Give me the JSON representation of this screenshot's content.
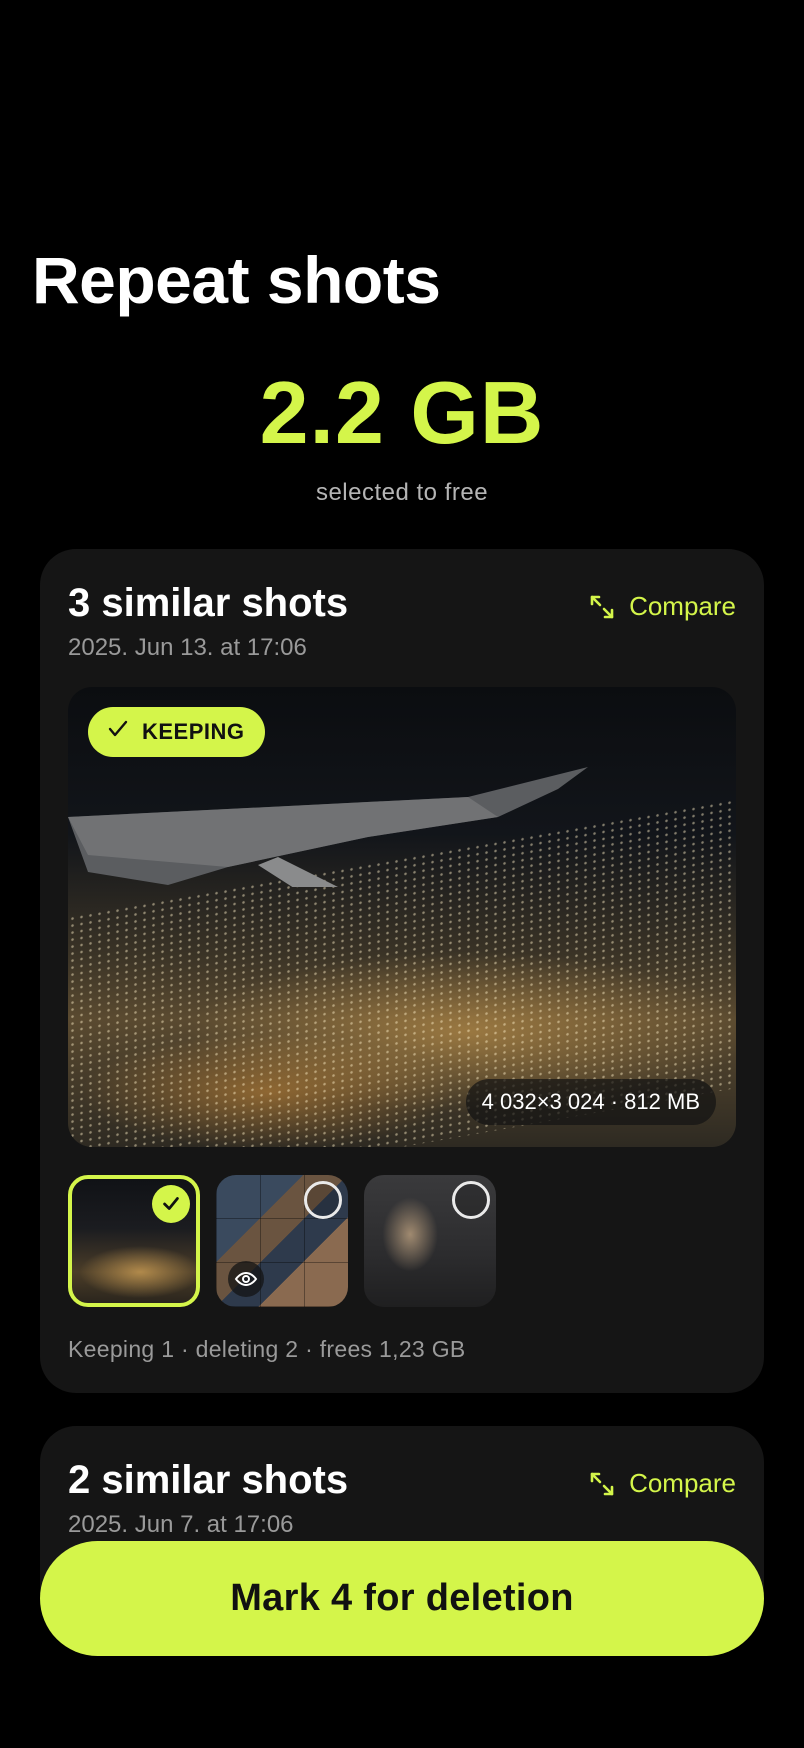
{
  "header": {
    "title": "Repeat shots",
    "amount": "2.2 GB",
    "amount_caption": "selected to free"
  },
  "groups": [
    {
      "title": "3 similar shots",
      "date": "2025. Jun 13. at 17:06",
      "compare_label": "Compare",
      "keeping_label": "KEEPING",
      "photo_meta": "4 032×3 024 · 812 MB",
      "thumbnails": [
        {
          "selected": true,
          "state": "keep"
        },
        {
          "selected": false,
          "state": "delete"
        },
        {
          "selected": false,
          "state": "delete"
        }
      ],
      "summary": "Keeping 1 · deleting 2 · frees 1,23 GB"
    },
    {
      "title": "2 similar shots",
      "date": "2025. Jun 7. at 17:06",
      "compare_label": "Compare"
    }
  ],
  "action": {
    "label": "Mark 4 for deletion"
  },
  "colors": {
    "accent": "#d4f54a",
    "background": "#000000",
    "card": "#151515",
    "muted_text": "#9a9a9a"
  },
  "icons": [
    "expand-icon",
    "check-icon",
    "eye-icon",
    "empty-radio-icon"
  ]
}
